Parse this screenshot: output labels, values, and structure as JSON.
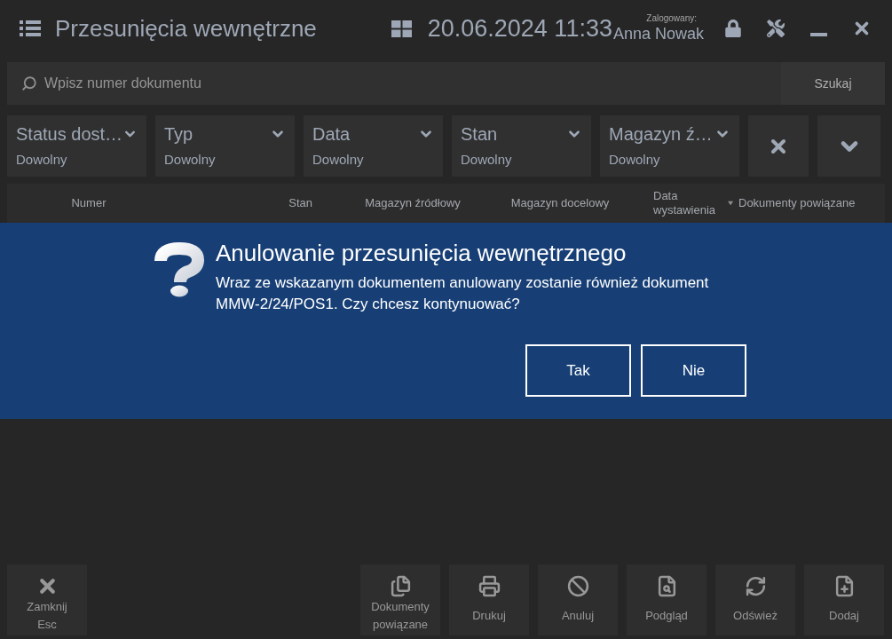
{
  "window": {
    "title": "Przesunięcia wewnętrzne",
    "datetime": "20.06.2024 11:33",
    "user_caption": "Zalogowany:",
    "user_name": "Anna Nowak"
  },
  "search": {
    "placeholder": "Wpisz numer dokumentu",
    "button": "Szukaj"
  },
  "filters": [
    {
      "label": "Status dost…",
      "value": "Dowolny"
    },
    {
      "label": "Typ",
      "value": "Dowolny"
    },
    {
      "label": "Data",
      "value": "Dowolny"
    },
    {
      "label": "Stan",
      "value": "Dowolny"
    },
    {
      "label": "Magazyn ź…",
      "value": "Dowolny"
    }
  ],
  "table": {
    "columns": [
      {
        "label": "Numer",
        "sorted": false
      },
      {
        "label": "Stan",
        "sorted": false
      },
      {
        "label": "Magazyn źródłowy",
        "sorted": false
      },
      {
        "label": "Magazyn docelowy",
        "sorted": false
      },
      {
        "label": "Data wystawienia",
        "sorted": true
      },
      {
        "label": "Dokumenty powiązane",
        "sorted": false
      }
    ]
  },
  "dialog": {
    "title": "Anulowanie przesunięcia wewnętrznego",
    "message": "Wraz ze wskazanym dokumentem anulowany zostanie również dokument MMW-2/24/POS1. Czy chcesz kontynuować?",
    "buttons": [
      {
        "label": "Tak"
      },
      {
        "label": "Nie"
      }
    ]
  },
  "toolbar": [
    {
      "kind": "close",
      "label": "Zamknij",
      "shortcut": "Esc"
    },
    {
      "kind": "related",
      "label": "Dokumenty powiązane"
    },
    {
      "kind": "print",
      "label": "Drukuj"
    },
    {
      "kind": "cancel",
      "label": "Anuluj"
    },
    {
      "kind": "preview",
      "label": "Podgląd"
    },
    {
      "kind": "refresh",
      "label": "Odśwież"
    },
    {
      "kind": "add",
      "label": "Dodaj"
    }
  ]
}
